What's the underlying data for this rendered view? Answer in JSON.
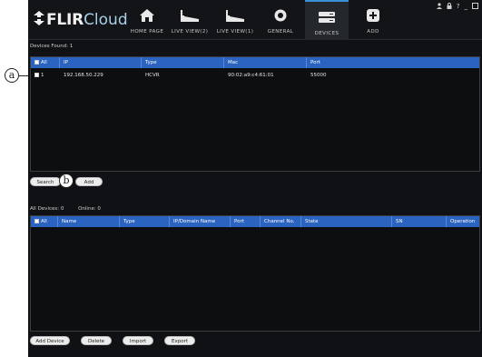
{
  "logo": {
    "brand": "FLIR",
    "suffix": "Cloud"
  },
  "nav": [
    {
      "label": "HOME PAGE",
      "icon": "home-icon"
    },
    {
      "label": "LIVE VIEW(2)",
      "icon": "camera-icon"
    },
    {
      "label": "LIVE VIEW(1)",
      "icon": "camera-icon"
    },
    {
      "label": "GENERAL",
      "icon": "gear-icon"
    },
    {
      "label": "DEVICES",
      "icon": "dvr-icon"
    },
    {
      "label": "ADD",
      "icon": "add-icon"
    }
  ],
  "top_icons": {
    "user": "user-icon",
    "lock": "lock-icon",
    "help": "?",
    "minimize": "_",
    "maximize": "maximize-icon"
  },
  "found": {
    "caption": "Devices Found: 1",
    "columns": [
      "All",
      "IP",
      "Type",
      "Mac",
      "Port"
    ],
    "rows": [
      {
        "num": "1",
        "ip": "192.168.50.229",
        "type": "HCVR",
        "mac": "90:02:a9:c4:61:01",
        "port": "55000"
      }
    ]
  },
  "found_buttons": {
    "search": "Search",
    "add": "Add"
  },
  "all_devices": {
    "caption_devices": "All Devices: 0",
    "caption_online": "Online: 0",
    "columns": [
      "All",
      "Name",
      "Type",
      "IP/Domain Name",
      "Port",
      "Channel No.",
      "State",
      "SN",
      "Operation"
    ]
  },
  "bottom_buttons": {
    "add_device": "Add Device",
    "delete": "Delete",
    "import": "Import",
    "export": "Export"
  },
  "callouts": {
    "a": "a",
    "b": "b"
  },
  "colors": {
    "header_bg": "#131417",
    "table_header": "#2a63c0",
    "accent": "#3a8fd8",
    "logo_cloud": "#a9d0e8"
  }
}
